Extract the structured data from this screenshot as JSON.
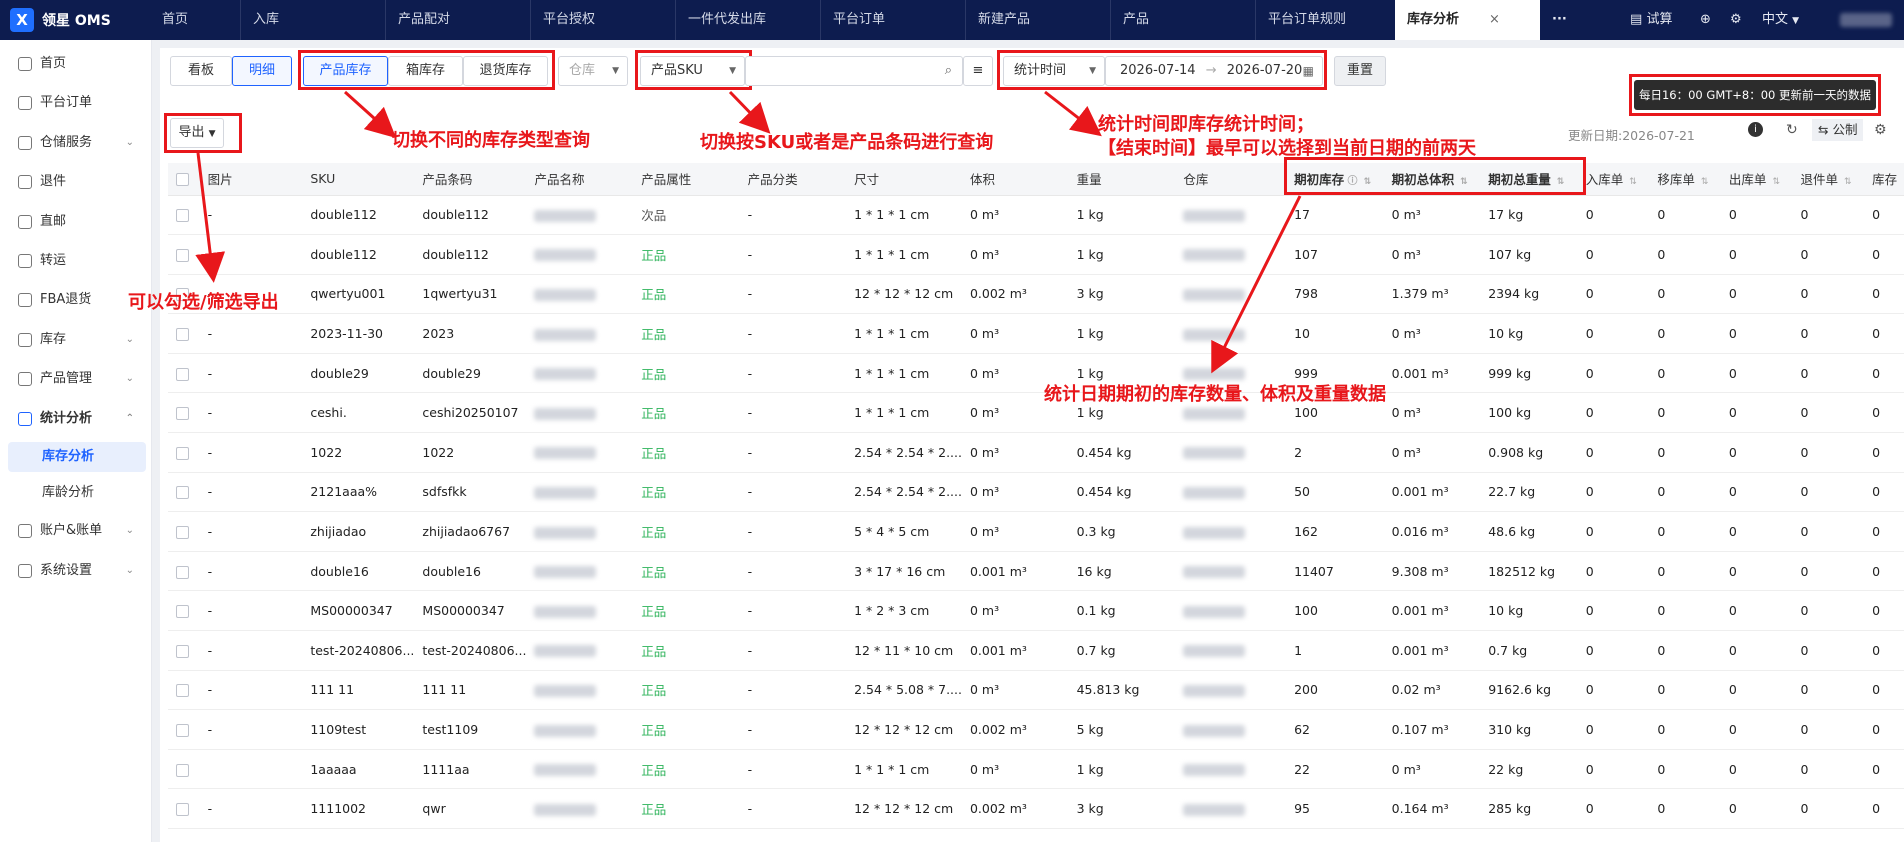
{
  "app": {
    "name": "领星 OMS",
    "logo_letter": "X"
  },
  "nav_tabs": [
    "首页",
    "入库",
    "产品配对",
    "平台授权",
    "一件代发出库",
    "平台订单",
    "新建产品",
    "产品",
    "平台订单规则",
    "库存分析"
  ],
  "nav_active": "库存分析",
  "nav_close": "×",
  "nav_more": "···",
  "top_right": {
    "trial": "试算",
    "lang": "中文"
  },
  "sidebar": {
    "items": [
      {
        "label": "首页"
      },
      {
        "label": "平台订单"
      },
      {
        "label": "仓储服务"
      },
      {
        "label": "退件"
      },
      {
        "label": "直邮"
      },
      {
        "label": "转运"
      },
      {
        "label": "FBA退货"
      },
      {
        "label": "库存"
      },
      {
        "label": "产品管理"
      },
      {
        "label": "统计分析"
      },
      {
        "label": "账户&账单"
      },
      {
        "label": "系统设置"
      }
    ],
    "subs": [
      {
        "label": "库存分析"
      },
      {
        "label": "库龄分析"
      }
    ]
  },
  "toolbar": {
    "view_board": "看板",
    "view_detail": "明细",
    "type_tabs": [
      "产品库存",
      "箱库存",
      "退货库存"
    ],
    "warehouse_placeholder": "仓库",
    "search_type": "产品SKU",
    "stat_time_label": "统计时间",
    "date_start": "2026-07-14",
    "date_end": "2026-07-20",
    "reset": "重置",
    "export": "导出",
    "update_date": "更新日期:2026-07-21",
    "public": "公制",
    "notice": "每日16：00 GMT+8：00 更新前一天的数据"
  },
  "annotations": {
    "a1": "切换不同的库存类型查询",
    "a2": "切换按SKU或者是产品条码进行查询",
    "a3_line1": "统计时间即库存统计时间；",
    "a3_line2": "【结束时间】最早可以选择到当前日期的前两天",
    "a4": "可以勾选/筛选导出",
    "a5": "统计日期期初的库存数量、体积及重量数据"
  },
  "table": {
    "headers": [
      "图片",
      "SKU",
      "产品条码",
      "产品名称",
      "产品属性",
      "产品分类",
      "尺寸",
      "体积",
      "重量",
      "仓库",
      "期初库存",
      "期初总体积",
      "期初总重量",
      "入库单",
      "移库单",
      "出库单",
      "退件单",
      "库存"
    ],
    "rows": [
      [
        "-",
        "double112",
        "double112",
        "",
        "次品",
        "-",
        "1 * 1 * 1  cm",
        "0  m³",
        "1  kg",
        "",
        "17",
        "0  m³",
        "17  kg",
        "0",
        "0",
        "0",
        "0",
        "0"
      ],
      [
        "-",
        "double112",
        "double112",
        "",
        "正品",
        "-",
        "1 * 1 * 1  cm",
        "0  m³",
        "1  kg",
        "",
        "107",
        "0  m³",
        "107  kg",
        "0",
        "0",
        "0",
        "0",
        "0"
      ],
      [
        "-",
        "qwertyu001",
        "1qwertyu31",
        "",
        "正品",
        "-",
        "12 * 12 * 12  cm",
        "0.002  m³",
        "3  kg",
        "",
        "798",
        "1.379  m³",
        "2394  kg",
        "0",
        "0",
        "0",
        "0",
        "0"
      ],
      [
        "-",
        "2023-11-30",
        "2023",
        "",
        "正品",
        "-",
        "1 * 1 * 1  cm",
        "0  m³",
        "1  kg",
        "",
        "10",
        "0  m³",
        "10  kg",
        "0",
        "0",
        "0",
        "0",
        "0"
      ],
      [
        "-",
        "double29",
        "double29",
        "",
        "正品",
        "-",
        "1 * 1 * 1  cm",
        "0  m³",
        "1  kg",
        "",
        "999",
        "0.001  m³",
        "999  kg",
        "0",
        "0",
        "0",
        "0",
        "0"
      ],
      [
        "-",
        "ceshi.",
        "ceshi20250107",
        "",
        "正品",
        "-",
        "1 * 1 * 1  cm",
        "0  m³",
        "1  kg",
        "",
        "100",
        "0  m³",
        "100  kg",
        "0",
        "0",
        "0",
        "0",
        "0"
      ],
      [
        "-",
        "1022",
        "1022",
        "",
        "正品",
        "-",
        "2.54 * 2.54 * 2....",
        "0  m³",
        "0.454  kg",
        "",
        "2",
        "0  m³",
        "0.908  kg",
        "0",
        "0",
        "0",
        "0",
        "0"
      ],
      [
        "-",
        "2121aaa%",
        "sdfsfkk",
        "",
        "正品",
        "-",
        "2.54 * 2.54 * 2....",
        "0  m³",
        "0.454  kg",
        "",
        "50",
        "0.001  m³",
        "22.7  kg",
        "0",
        "0",
        "0",
        "0",
        "0"
      ],
      [
        "-",
        "zhijiadao",
        "zhijiadao6767",
        "",
        "正品",
        "-",
        "5 * 4 * 5  cm",
        "0  m³",
        "0.3  kg",
        "",
        "162",
        "0.016  m³",
        "48.6  kg",
        "0",
        "0",
        "0",
        "0",
        "0"
      ],
      [
        "-",
        "double16",
        "double16",
        "",
        "正品",
        "-",
        "3 * 17 * 16  cm",
        "0.001  m³",
        "16  kg",
        "",
        "11407",
        "9.308  m³",
        "182512  kg",
        "0",
        "0",
        "0",
        "0",
        "0"
      ],
      [
        "-",
        "MS00000347",
        "MS00000347",
        "",
        "正品",
        "-",
        "1 * 2 * 3  cm",
        "0  m³",
        "0.1  kg",
        "",
        "100",
        "0.001  m³",
        "10  kg",
        "0",
        "0",
        "0",
        "0",
        "0"
      ],
      [
        "-",
        "test-20240806...",
        "test-20240806...",
        "",
        "正品",
        "-",
        "12 * 11 * 10  cm",
        "0.001  m³",
        "0.7  kg",
        "",
        "1",
        "0.001  m³",
        "0.7  kg",
        "0",
        "0",
        "0",
        "0",
        "0"
      ],
      [
        "-",
        "111 11",
        "111 11",
        "",
        "正品",
        "-",
        "2.54 * 5.08 * 7....",
        "0  m³",
        "45.813  kg",
        "",
        "200",
        "0.02  m³",
        "9162.6  kg",
        "0",
        "0",
        "0",
        "0",
        "0"
      ],
      [
        "-",
        "1109test",
        "test1109",
        "",
        "正品",
        "-",
        "12 * 12 * 12  cm",
        "0.002  m³",
        "5  kg",
        "",
        "62",
        "0.107  m³",
        "310  kg",
        "0",
        "0",
        "0",
        "0",
        "0"
      ],
      [
        "",
        "1aaaaa",
        "1111aa",
        "",
        "正品",
        "-",
        "1 * 1 * 1  cm",
        "0  m³",
        "1  kg",
        "",
        "22",
        "0  m³",
        "22  kg",
        "0",
        "0",
        "0",
        "0",
        "0"
      ],
      [
        "-",
        "1111002",
        "qwr",
        "",
        "正品",
        "-",
        "12 * 12 * 12  cm",
        "0.002  m³",
        "3  kg",
        "",
        "95",
        "0.164  m³",
        "285  kg",
        "0",
        "0",
        "0",
        "0",
        "0"
      ]
    ]
  },
  "colors": {
    "nav_bg": "#0d1c4f",
    "accent": "#1f63ff",
    "annotation": "#e8171b",
    "good": "#2db35a"
  }
}
